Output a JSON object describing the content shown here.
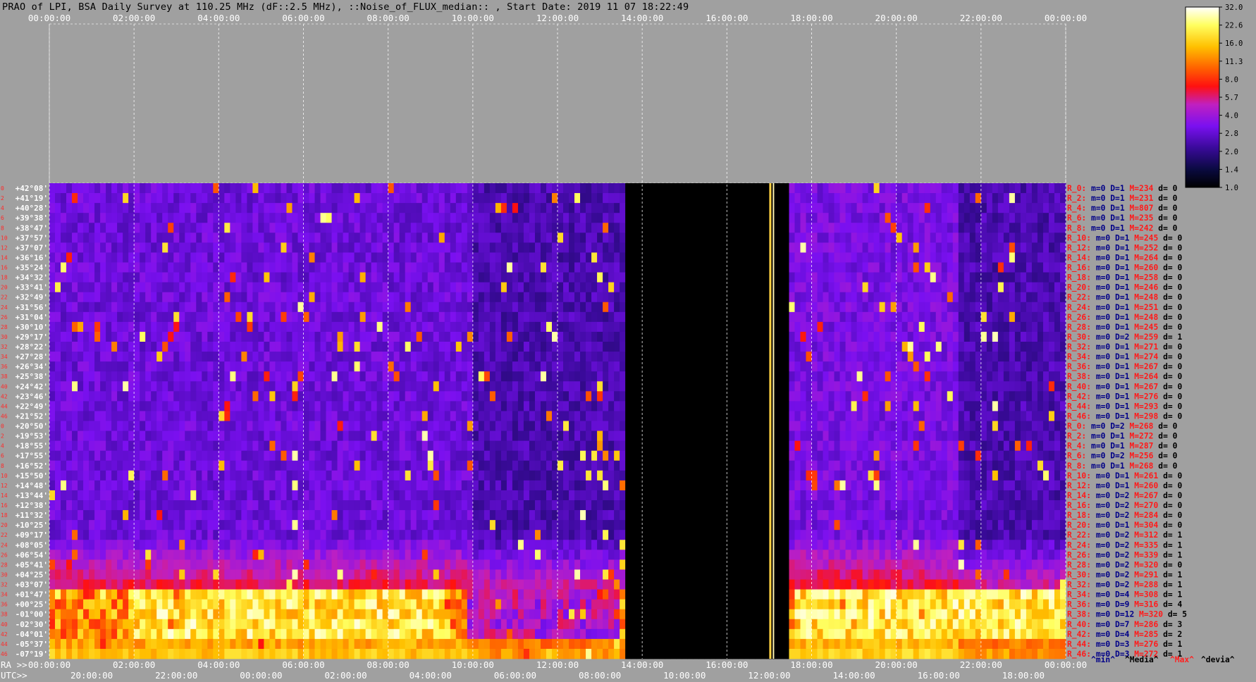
{
  "header": {
    "title": "PRAO of LPI, BSA Daily Survey at 110.25 MHz (dF::2.5 MHz), ::Noise_of_FLUX_median:: , Start Date: 2019 11 07 18:22:49"
  },
  "chart_data": {
    "type": "heatmap",
    "x_axis_top": {
      "labels": [
        "00:00:00",
        "02:00:00",
        "04:00:00",
        "06:00:00",
        "08:00:00",
        "10:00:00",
        "12:00:00",
        "14:00:00",
        "16:00:00",
        "18:00:00",
        "20:00:00",
        "22:00:00",
        "00:00:00"
      ]
    },
    "x_axis_ra": {
      "prefix": "RA >>",
      "labels": [
        "00:00:00",
        "02:00:00",
        "04:00:00",
        "06:00:00",
        "08:00:00",
        "10:00:00",
        "12:00:00",
        "14:00:00",
        "16:00:00",
        "18:00:00",
        "20:00:00",
        "22:00:00",
        "00:00:00"
      ]
    },
    "x_axis_utc": {
      "prefix": "UTC>>",
      "labels": [
        "20:00:00",
        "22:00:00",
        "00:00:00",
        "02:00:00",
        "04:00:00",
        "06:00:00",
        "08:00:00",
        "10:00:00",
        "12:00:00",
        "14:00:00",
        "16:00:00",
        "18:00:00"
      ]
    },
    "y_axis": {
      "declinations": [
        "+42°08'",
        "+41°19'",
        "+40°28'",
        "+39°38'",
        "+38°47'",
        "+37°57'",
        "+37°07'",
        "+36°16'",
        "+35°24'",
        "+34°32'",
        "+33°41'",
        "+32°49'",
        "+31°56'",
        "+31°04'",
        "+30°10'",
        "+29°17'",
        "+28°22'",
        "+27°28'",
        "+26°34'",
        "+25°38'",
        "+24°42'",
        "+23°46'",
        "+22°49'",
        "+21°52'",
        "+20°50'",
        "+19°53'",
        "+18°55'",
        "+17°55'",
        "+16°52'",
        "+15°50'",
        "+14°48'",
        "+13°44'",
        "+12°38'",
        "+11°32'",
        "+10°25'",
        "+09°17'",
        "+08°05'",
        "+06°54'",
        "+05°41'",
        "+04°25'",
        "+03°07'",
        "+01°47'",
        "+00°25'",
        "-01°00'",
        "-02°30'",
        "-04°01'",
        "-05°37'",
        "-07°19'"
      ],
      "row_indices": [
        "0",
        "2",
        "4",
        "6",
        "8",
        "10",
        "12",
        "14",
        "16",
        "18",
        "20",
        "22",
        "24",
        "26",
        "28",
        "30",
        "32",
        "34",
        "36",
        "38",
        "40",
        "42",
        "44",
        "46",
        "0",
        "2",
        "4",
        "6",
        "8",
        "10",
        "12",
        "14",
        "16",
        "18",
        "20",
        "22",
        "24",
        "26",
        "28",
        "30",
        "32",
        "34",
        "36",
        "38",
        "40",
        "42",
        "44",
        "46"
      ]
    },
    "colorbar": {
      "ticks": [
        "32.0",
        "22.6",
        "16.0",
        "11.3",
        "8.0",
        "5.7",
        "4.0",
        "2.8",
        "2.0",
        "1.4",
        "1.0"
      ],
      "scale": "log",
      "range": [
        1.0,
        32.0
      ],
      "colors": [
        "#000000",
        "#0a0a40",
        "#3a0a9a",
        "#7a10f0",
        "#c020c0",
        "#ff1010",
        "#ff6000",
        "#ffc000",
        "#ffff60",
        "#ffffff"
      ]
    },
    "row_stats": [
      {
        "r": "R_0:",
        "m": "m=0",
        "d": "D=1",
        "M": "M=234",
        "dv": "d= 0"
      },
      {
        "r": "R_2:",
        "m": "m=0",
        "d": "D=1",
        "M": "M=231",
        "dv": "d= 0"
      },
      {
        "r": "R_4:",
        "m": "m=0",
        "d": "D=1",
        "M": "M=807",
        "dv": "d= 0"
      },
      {
        "r": "R_6:",
        "m": "m=0",
        "d": "D=1",
        "M": "M=235",
        "dv": "d= 0"
      },
      {
        "r": "R_8:",
        "m": "m=0",
        "d": "D=1",
        "M": "M=242",
        "dv": "d= 0"
      },
      {
        "r": "R_10:",
        "m": "m=0",
        "d": "D=1",
        "M": "M=245",
        "dv": "d= 0"
      },
      {
        "r": "R_12:",
        "m": "m=0",
        "d": "D=1",
        "M": "M=252",
        "dv": "d= 0"
      },
      {
        "r": "R_14:",
        "m": "m=0",
        "d": "D=1",
        "M": "M=264",
        "dv": "d= 0"
      },
      {
        "r": "R_16:",
        "m": "m=0",
        "d": "D=1",
        "M": "M=260",
        "dv": "d= 0"
      },
      {
        "r": "R_18:",
        "m": "m=0",
        "d": "D=1",
        "M": "M=258",
        "dv": "d= 0"
      },
      {
        "r": "R_20:",
        "m": "m=0",
        "d": "D=1",
        "M": "M=246",
        "dv": "d= 0"
      },
      {
        "r": "R_22:",
        "m": "m=0",
        "d": "D=1",
        "M": "M=248",
        "dv": "d= 0"
      },
      {
        "r": "R_24:",
        "m": "m=0",
        "d": "D=1",
        "M": "M=251",
        "dv": "d= 0"
      },
      {
        "r": "R_26:",
        "m": "m=0",
        "d": "D=1",
        "M": "M=248",
        "dv": "d= 0"
      },
      {
        "r": "R_28:",
        "m": "m=0",
        "d": "D=1",
        "M": "M=245",
        "dv": "d= 0"
      },
      {
        "r": "R_30:",
        "m": "m=0",
        "d": "D=2",
        "M": "M=259",
        "dv": "d= 1"
      },
      {
        "r": "R_32:",
        "m": "m=0",
        "d": "D=1",
        "M": "M=271",
        "dv": "d= 0"
      },
      {
        "r": "R_34:",
        "m": "m=0",
        "d": "D=1",
        "M": "M=274",
        "dv": "d= 0"
      },
      {
        "r": "R_36:",
        "m": "m=0",
        "d": "D=1",
        "M": "M=267",
        "dv": "d= 0"
      },
      {
        "r": "R_38:",
        "m": "m=0",
        "d": "D=1",
        "M": "M=264",
        "dv": "d= 0"
      },
      {
        "r": "R_40:",
        "m": "m=0",
        "d": "D=1",
        "M": "M=267",
        "dv": "d= 0"
      },
      {
        "r": "R_42:",
        "m": "m=0",
        "d": "D=1",
        "M": "M=276",
        "dv": "d= 0"
      },
      {
        "r": "R_44:",
        "m": "m=0",
        "d": "D=1",
        "M": "M=293",
        "dv": "d= 0"
      },
      {
        "r": "R_46:",
        "m": "m=0",
        "d": "D=1",
        "M": "M=298",
        "dv": "d= 0"
      },
      {
        "r": "R_0:",
        "m": "m=0",
        "d": "D=2",
        "M": "M=268",
        "dv": "d= 0"
      },
      {
        "r": "R_2:",
        "m": "m=0",
        "d": "D=1",
        "M": "M=272",
        "dv": "d= 0"
      },
      {
        "r": "R_4:",
        "m": "m=0",
        "d": "D=1",
        "M": "M=287",
        "dv": "d= 0"
      },
      {
        "r": "R_6:",
        "m": "m=0",
        "d": "D=2",
        "M": "M=256",
        "dv": "d= 0"
      },
      {
        "r": "R_8:",
        "m": "m=0",
        "d": "D=1",
        "M": "M=268",
        "dv": "d= 0"
      },
      {
        "r": "R_10:",
        "m": "m=0",
        "d": "D=1",
        "M": "M=261",
        "dv": "d= 0"
      },
      {
        "r": "R_12:",
        "m": "m=0",
        "d": "D=1",
        "M": "M=260",
        "dv": "d= 0"
      },
      {
        "r": "R_14:",
        "m": "m=0",
        "d": "D=2",
        "M": "M=267",
        "dv": "d= 0"
      },
      {
        "r": "R_16:",
        "m": "m=0",
        "d": "D=2",
        "M": "M=270",
        "dv": "d= 0"
      },
      {
        "r": "R_18:",
        "m": "m=0",
        "d": "D=2",
        "M": "M=284",
        "dv": "d= 0"
      },
      {
        "r": "R_20:",
        "m": "m=0",
        "d": "D=1",
        "M": "M=304",
        "dv": "d= 0"
      },
      {
        "r": "R_22:",
        "m": "m=0",
        "d": "D=2",
        "M": "M=312",
        "dv": "d= 1"
      },
      {
        "r": "R_24:",
        "m": "m=0",
        "d": "D=2",
        "M": "M=335",
        "dv": "d= 1"
      },
      {
        "r": "R_26:",
        "m": "m=0",
        "d": "D=2",
        "M": "M=339",
        "dv": "d= 1"
      },
      {
        "r": "R_28:",
        "m": "m=0",
        "d": "D=2",
        "M": "M=320",
        "dv": "d= 0"
      },
      {
        "r": "R_30:",
        "m": "m=0",
        "d": "D=2",
        "M": "M=291",
        "dv": "d= 1"
      },
      {
        "r": "R_32:",
        "m": "m=0",
        "d": "D=2",
        "M": "M=288",
        "dv": "d= 1"
      },
      {
        "r": "R_34:",
        "m": "m=0",
        "d": "D=4",
        "M": "M=308",
        "dv": "d= 1"
      },
      {
        "r": "R_36:",
        "m": "m=0",
        "d": "D=9",
        "M": "M=316",
        "dv": "d= 4"
      },
      {
        "r": "R_38:",
        "m": "m=0",
        "d": "D=12",
        "M": "M=320",
        "dv": "d= 5"
      },
      {
        "r": "R_40:",
        "m": "m=0",
        "d": "D=7",
        "M": "M=286",
        "dv": "d= 3"
      },
      {
        "r": "R_42:",
        "m": "m=0",
        "d": "D=4",
        "M": "M=285",
        "dv": "d= 2"
      },
      {
        "r": "R_44:",
        "m": "m=0",
        "d": "D=3",
        "M": "M=276",
        "dv": "d= 1"
      },
      {
        "r": "R_46:",
        "m": "m=0",
        "d": "D=3",
        "M": "M=272",
        "dv": "d= 1"
      }
    ],
    "legend_footer": {
      "min": "^min^",
      "media": "^Media^",
      "max": "^Max^",
      "devia": "^devia^"
    },
    "gap_region_ra": [
      "13:35:00",
      "17:25:00"
    ]
  },
  "colors": {
    "background": "#a0a0a0",
    "stat_label": "#ff1a1a",
    "stat_value": "#000088",
    "max_label": "#ff2020"
  }
}
